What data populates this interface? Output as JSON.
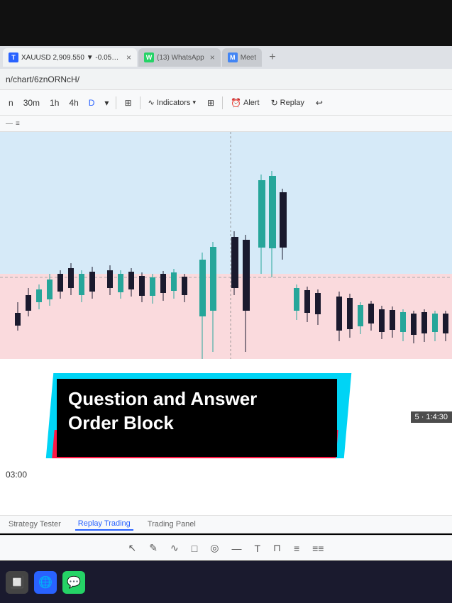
{
  "browser": {
    "tabs": [
      {
        "id": "tab-tv",
        "favicon_type": "tv",
        "favicon_label": "T",
        "label": "XAUUSD 2,909.550 ▼ -0.05% (",
        "active": true,
        "close_label": "×"
      },
      {
        "id": "tab-wa",
        "favicon_type": "wa",
        "favicon_label": "W",
        "label": "(13) WhatsApp",
        "active": false,
        "close_label": "×"
      },
      {
        "id": "tab-meet",
        "favicon_type": "meet",
        "favicon_label": "M",
        "label": "Meet",
        "active": false,
        "close_label": ""
      }
    ],
    "address": "n/chart/6znORNcH/"
  },
  "toolbar": {
    "timeframes": [
      "n",
      "30m",
      "1h",
      "4h",
      "D",
      "~"
    ],
    "active_timeframe": "D",
    "tools": [
      {
        "id": "candle",
        "label": "Candles"
      },
      {
        "id": "indicators",
        "label": "Indicators"
      },
      {
        "id": "layout",
        "label": ""
      },
      {
        "id": "alert",
        "label": "Alert"
      },
      {
        "id": "replay",
        "label": "Replay"
      },
      {
        "id": "undo",
        "label": "↩"
      }
    ]
  },
  "mini_toolbar": {
    "items": [
      "—",
      "≡"
    ]
  },
  "chart": {
    "time_label": "03:00",
    "status_time": "5 · 1:4:30"
  },
  "overlay": {
    "title_line1": "Question and Answer",
    "title_line2": "Order Block"
  },
  "bottom_tabs": [
    {
      "id": "strategy-tester",
      "label": "Strategy Tester",
      "active": false
    },
    {
      "id": "replay-trading",
      "label": "Replay Trading",
      "active": true
    },
    {
      "id": "trading-panel",
      "label": "Trading Panel",
      "active": false
    }
  ],
  "drawing_tools": [
    "✎",
    "∿",
    "□",
    "◎",
    "—",
    "T",
    "⊓",
    "≡",
    "≡≡"
  ],
  "taskbar": {
    "icons": [
      "🔲",
      "🌐",
      "😊"
    ]
  }
}
